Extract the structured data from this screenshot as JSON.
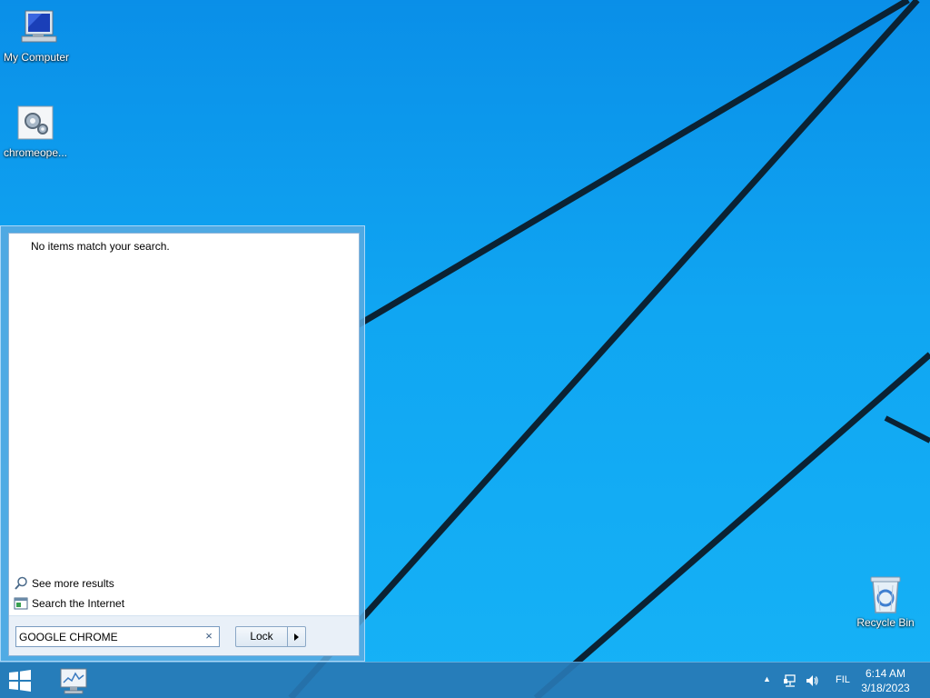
{
  "desktop": {
    "icons": [
      {
        "label": "My Computer"
      },
      {
        "label": "chromeope..."
      },
      {
        "label": "Recycle Bin"
      }
    ]
  },
  "start_menu": {
    "no_results_text": "No items match your search.",
    "see_more_results": "See more results",
    "search_internet": "Search the Internet",
    "search_value": "GOOGLE CHROME",
    "clear_symbol": "×",
    "lock_label": "Lock"
  },
  "taskbar": {
    "language": "FIL",
    "time": "6:14 AM",
    "date": "3/18/2023"
  },
  "colors": {
    "wallpaper_top": "#0a8fe8",
    "wallpaper_bottom": "#16b2f6",
    "wallpaper_lines": "#0b2233",
    "taskbar": "#2878b4"
  }
}
